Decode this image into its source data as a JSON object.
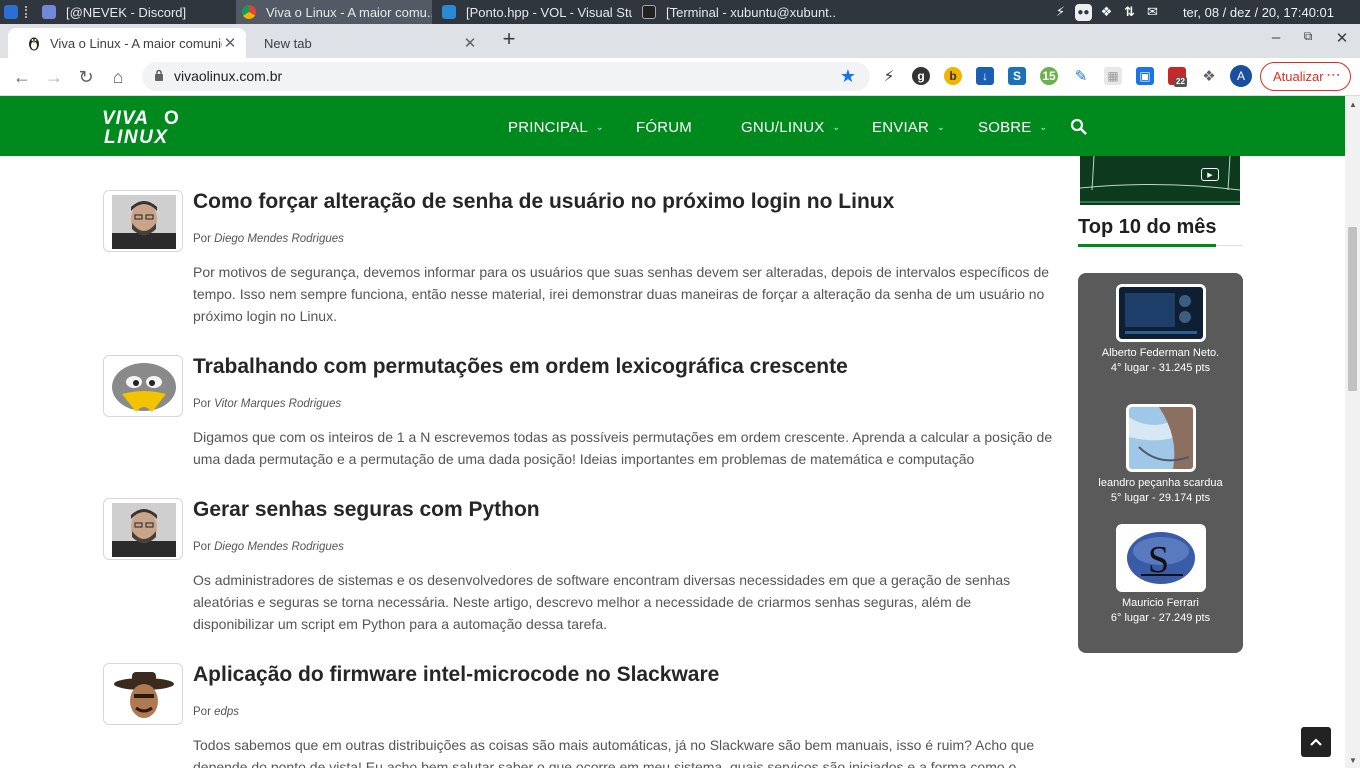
{
  "taskbar": {
    "windows": [
      {
        "label": "[@NEVEK - Discord]",
        "icon": "discord-icon",
        "active": false
      },
      {
        "label": "Viva o Linux - A maior comu...",
        "icon": "chrome-icon",
        "active": true
      },
      {
        "label": "[Ponto.hpp - VOL - Visual Stu...",
        "icon": "vscode-icon",
        "active": false
      },
      {
        "label": "[Terminal - xubuntu@xubunt...",
        "icon": "terminal-icon",
        "active": false
      }
    ],
    "clock": "ter, 08 / dez / 20, 17:40:01"
  },
  "browser": {
    "tabs": [
      {
        "title": "Viva o Linux - A maior comunida",
        "active": true
      },
      {
        "title": "New tab",
        "active": false
      }
    ],
    "url": "vivaolinux.com.br",
    "update_label": "Atualizar",
    "avatar_letter": "A",
    "extension_badge": "22"
  },
  "site": {
    "menu": [
      "PRINCIPAL",
      "FÓRUM",
      "GNU/LINUX",
      "ENVIAR",
      "SOBRE"
    ],
    "menu_has_dropdown": [
      true,
      false,
      true,
      true,
      true
    ],
    "articles": [
      {
        "title": "Como forçar alteração de senha de usuário no próximo login no Linux",
        "by_prefix": "Por",
        "author": "Diego Mendes Rodrigues",
        "summary": "Por motivos de segurança, devemos informar para os usuários que suas senhas devem ser alteradas, depois de intervalos específicos de tempo. Isso nem sempre funciona, então nesse material, irei demonstrar duas maneiras de forçar a alteração da senha de um usuário no próximo login no Linux."
      },
      {
        "title": "Trabalhando com permutações em ordem lexicográfica crescente",
        "by_prefix": "Por",
        "author": "Vitor Marques Rodrigues",
        "summary": "Digamos que com os inteiros de 1 a N escrevemos todas as possíveis permutações em ordem crescente. Aprenda a calcular a posição de uma dada permutação e a permutação de uma dada posição! Ideias importantes em problemas de matemática e computação"
      },
      {
        "title": "Gerar senhas seguras com Python",
        "by_prefix": "Por",
        "author": "Diego Mendes Rodrigues",
        "summary": "Os administradores de sistemas e os desenvolvedores de software encontram diversas necessidades em que a geração de senhas aleatórias e seguras se torna necessária. Neste artigo, descrevo melhor a necessidade de criarmos senhas seguras, além de disponibilizar um script em Python para a automação dessa tarefa."
      },
      {
        "title": "Aplicação do firmware intel-microcode no Slackware",
        "by_prefix": "Por",
        "author": "edps",
        "summary": "Todos sabemos que em outras distribuições as coisas são mais automáticas, já no Slackware são bem manuais, isso é ruim? Acho que depende do ponto de vista! Eu acho bem salutar saber o que ocorre em meu sistema, quais serviços são iniciados e a forma como o"
      }
    ],
    "top10": {
      "title": "Top 10 do mês",
      "entries": [
        {
          "name": "Alberto Federman Neto.",
          "score": "4° lugar - 31.245 pts"
        },
        {
          "name": "leandro peçanha scardua",
          "score": "5° lugar - 29.174 pts"
        },
        {
          "name": "Mauricio Ferrari",
          "score": "6° lugar - 27.249 pts"
        }
      ]
    }
  },
  "colors": {
    "site_green": "#008a1e",
    "taskbar_bg": "#30363e",
    "update_red": "#d93025"
  }
}
